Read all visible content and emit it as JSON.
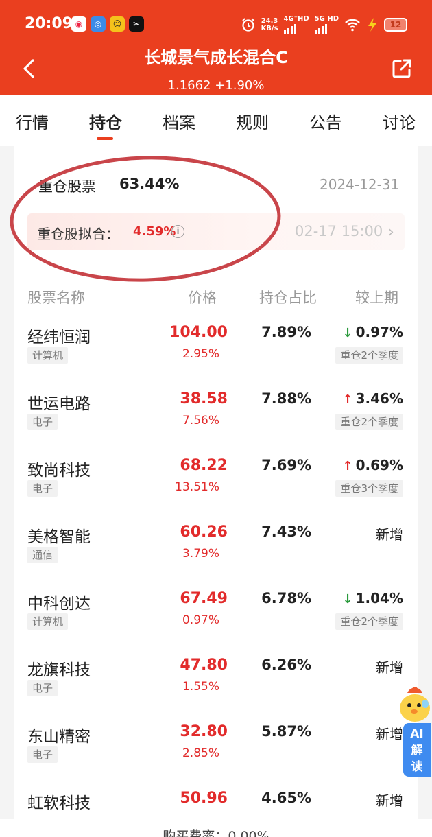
{
  "status_bar": {
    "time": "20:09",
    "net_speed": "24.3",
    "net_unit": "KB/s",
    "sig1": "4G⁺HD",
    "sig2": "5G HD",
    "battery": "12",
    "app_icons": [
      "circle-app-icon",
      "swirl-app-icon",
      "face-app-icon",
      "capcut-app-icon"
    ],
    "right_icons": [
      "alarm-icon",
      "wifi-icon",
      "charging-icon"
    ]
  },
  "header": {
    "title": "长城景气成长混合C",
    "nav_value": "1.1662",
    "nav_change": "+1.90%",
    "subtitle": "1.1662 +1.90%",
    "background": "#ea3f1f"
  },
  "tabs": [
    {
      "label": "行情",
      "active": false
    },
    {
      "label": "持仓",
      "active": true
    },
    {
      "label": "档案",
      "active": false
    },
    {
      "label": "规则",
      "active": false
    },
    {
      "label": "公告",
      "active": false
    },
    {
      "label": "讨论",
      "active": false
    }
  ],
  "holdings_summary": {
    "label": "重仓股票",
    "value": "63.44%",
    "date": "2024-12-31",
    "fit_label": "重仓股拟合：",
    "fit_value": "4.59%",
    "fit_info_icon": "ⓘ",
    "fit_time": "02-17 15:00",
    "chevron": "›"
  },
  "table_headers": {
    "name": "股票名称",
    "price": "价格",
    "weight": "持仓占比",
    "change": "较上期"
  },
  "stocks": [
    {
      "name": "经纬恒润",
      "industry": "计算机",
      "price": "104.00",
      "pct": "2.95%",
      "weight": "7.89%",
      "change": "0.97%",
      "direction": "down",
      "arrow": "↓",
      "tag": "重仓2个季度"
    },
    {
      "name": "世运电路",
      "industry": "电子",
      "price": "38.58",
      "pct": "7.56%",
      "weight": "7.88%",
      "change": "3.46%",
      "direction": "up",
      "arrow": "↑",
      "tag": "重仓2个季度"
    },
    {
      "name": "致尚科技",
      "industry": "电子",
      "price": "68.22",
      "pct": "13.51%",
      "weight": "7.69%",
      "change": "0.69%",
      "direction": "up",
      "arrow": "↑",
      "tag": "重仓3个季度"
    },
    {
      "name": "美格智能",
      "industry": "通信",
      "price": "60.26",
      "pct": "3.79%",
      "weight": "7.43%",
      "change": "新增",
      "direction": "new",
      "arrow": "",
      "tag": ""
    },
    {
      "name": "中科创达",
      "industry": "计算机",
      "price": "67.49",
      "pct": "0.97%",
      "weight": "6.78%",
      "change": "1.04%",
      "direction": "down",
      "arrow": "↓",
      "tag": "重仓2个季度"
    },
    {
      "name": "龙旗科技",
      "industry": "电子",
      "price": "47.80",
      "pct": "1.55%",
      "weight": "6.26%",
      "change": "新增",
      "direction": "new",
      "arrow": "",
      "tag": ""
    },
    {
      "name": "东山精密",
      "industry": "电子",
      "price": "32.80",
      "pct": "2.85%",
      "weight": "5.87%",
      "change": "新增",
      "direction": "new",
      "arrow": "",
      "tag": ""
    },
    {
      "name": "虹软科技",
      "industry": "",
      "price": "50.96",
      "pct": "",
      "weight": "4.65%",
      "change": "新增",
      "direction": "new",
      "arrow": "",
      "tag": ""
    }
  ],
  "footer": {
    "fee": "购买费率：0.00%"
  },
  "ai_button": {
    "line1": "AI",
    "line2": "解",
    "line3": "读"
  },
  "colors": {
    "up": "#e22b2b",
    "down": "#2a9a3c",
    "annotation": "#c9454a",
    "ai": "#3f8bf0"
  }
}
